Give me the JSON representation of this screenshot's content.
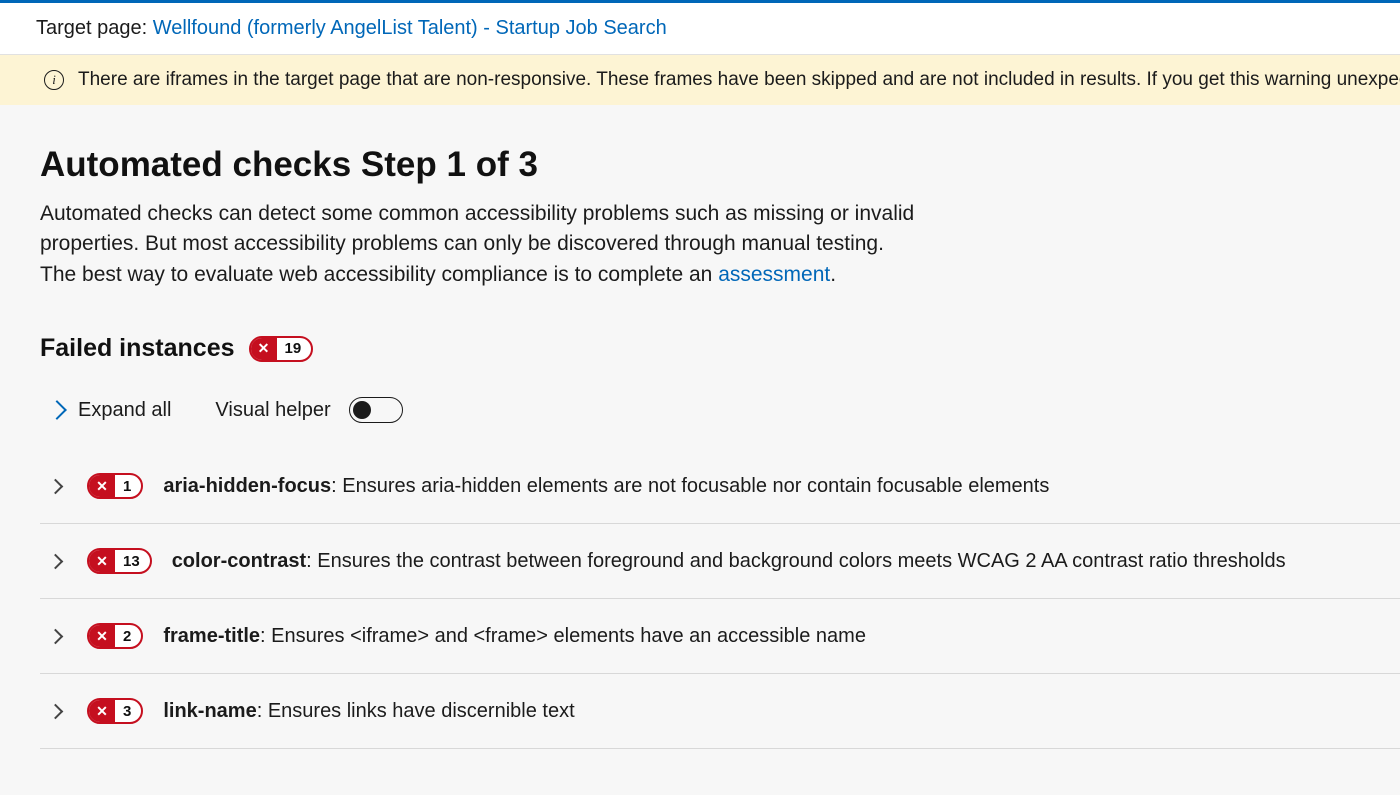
{
  "target": {
    "label": "Target page: ",
    "link_text": "Wellfound (formerly AngelList Talent) - Startup Job Search"
  },
  "warning": {
    "text": "There are iframes in the target page that are non-responsive. These frames have been skipped and are not included in results. If you get this warning unexpectedly in"
  },
  "heading": "Automated checks Step 1 of 3",
  "description": {
    "part1": "Automated checks can detect some common accessibility problems such as missing or invalid properties. But most accessibility problems can only be discovered through manual testing. The best way to evaluate web accessibility compliance is to complete an ",
    "link": "assessment",
    "part2": "."
  },
  "failed": {
    "label": "Failed instances",
    "total": "19"
  },
  "controls": {
    "expand_all": "Expand all",
    "visual_helper": "Visual helper"
  },
  "rules": [
    {
      "count": "1",
      "name": "aria-hidden-focus",
      "desc": ": Ensures aria-hidden elements are not focusable nor contain focusable elements"
    },
    {
      "count": "13",
      "name": "color-contrast",
      "desc": ": Ensures the contrast between foreground and background colors meets WCAG 2 AA contrast ratio thresholds"
    },
    {
      "count": "2",
      "name": "frame-title",
      "desc": ": Ensures <iframe> and <frame> elements have an accessible name"
    },
    {
      "count": "3",
      "name": "link-name",
      "desc": ": Ensures links have discernible text"
    }
  ]
}
